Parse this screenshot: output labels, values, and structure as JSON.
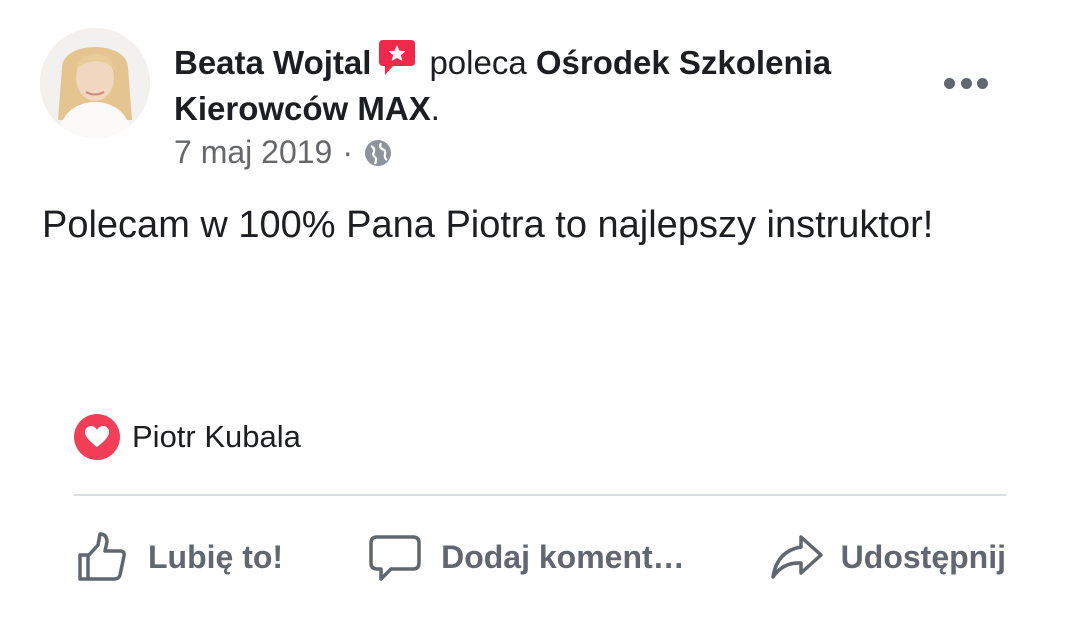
{
  "post": {
    "author": "Beata Wojtal",
    "verb": "poleca",
    "page_name_line1": "Ośrodek Szkolenia",
    "page_name_line2": "Kierowców MAX",
    "page_suffix": ".",
    "date": "7 maj 2019",
    "separator": "·",
    "text": "Polecam w 100% Pana Piotra to najlepszy instruktor!",
    "recommend_icon": "recommendation-star-bubble-icon",
    "privacy_icon": "globe-icon",
    "menu_icon": "more-options-icon"
  },
  "reactions": {
    "icon": "love-heart-icon",
    "name": "Piotr Kubala"
  },
  "actions": {
    "like": "Lubię to!",
    "comment": "Dodaj koment…",
    "share": "Udostępnij"
  },
  "colors": {
    "recommend_red": "#f0284a",
    "love_red": "#f33e58",
    "muted_gray": "#65676b",
    "divider": "#dadde1"
  }
}
